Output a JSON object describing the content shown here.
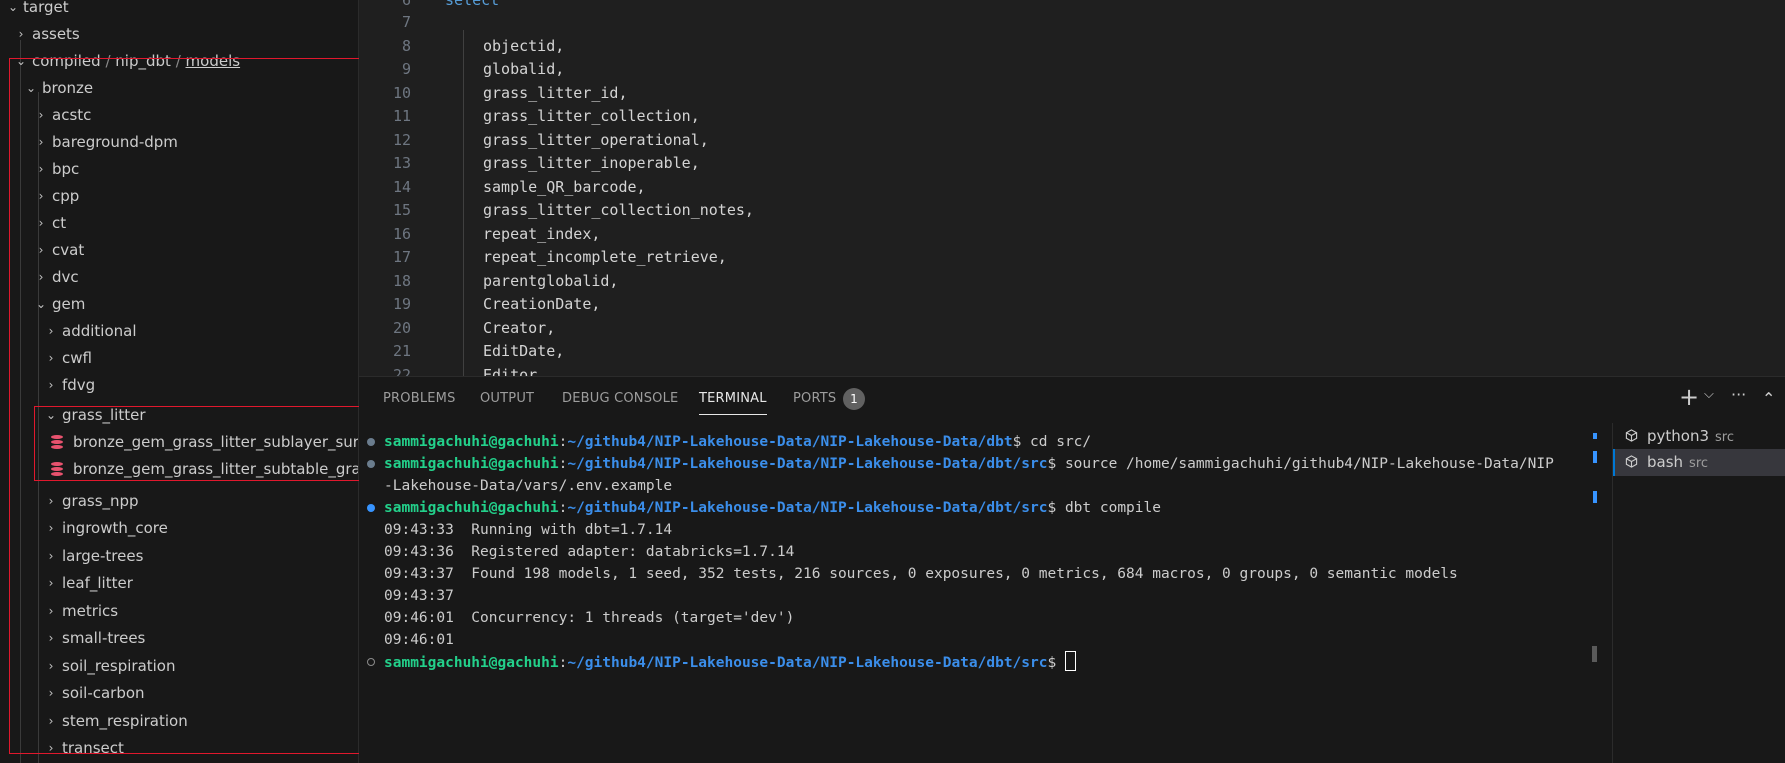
{
  "explorer": {
    "items": [
      {
        "label": "target",
        "expanded": true
      },
      {
        "label": "assets",
        "expanded": false
      },
      {
        "label_parts": [
          "compiled",
          "/",
          "nip_dbt",
          "/",
          "models"
        ],
        "expanded": true
      },
      {
        "label": "bronze",
        "expanded": true
      },
      {
        "label": "acstc",
        "expanded": false
      },
      {
        "label": "bareground-dpm",
        "expanded": false
      },
      {
        "label": "bpc",
        "expanded": false
      },
      {
        "label": "cpp",
        "expanded": false
      },
      {
        "label": "ct",
        "expanded": false
      },
      {
        "label": "cvat",
        "expanded": false
      },
      {
        "label": "dvc",
        "expanded": false
      },
      {
        "label": "gem",
        "expanded": true
      },
      {
        "label": "additional",
        "expanded": false
      },
      {
        "label": "cwfl",
        "expanded": false
      },
      {
        "label": "fdvg",
        "expanded": false
      },
      {
        "label": "grass_litter",
        "expanded": true
      },
      {
        "label": "bronze_gem_grass_litter_sublayer_sur...",
        "file": true
      },
      {
        "label": "bronze_gem_grass_litter_subtable_gra...",
        "file": true
      },
      {
        "label": "grass_npp",
        "expanded": false
      },
      {
        "label": "ingrowth_core",
        "expanded": false
      },
      {
        "label": "large-trees",
        "expanded": false
      },
      {
        "label": "leaf_litter",
        "expanded": false
      },
      {
        "label": "metrics",
        "expanded": false
      },
      {
        "label": "small-trees",
        "expanded": false
      },
      {
        "label": "soil_respiration",
        "expanded": false
      },
      {
        "label": "soil-carbon",
        "expanded": false
      },
      {
        "label": "stem_respiration",
        "expanded": false
      },
      {
        "label": "transect",
        "expanded": false
      }
    ]
  },
  "editor": {
    "lines": [
      {
        "num": "6",
        "code": "select",
        "keyword": true
      },
      {
        "num": "7",
        "code": ""
      },
      {
        "num": "8",
        "code": "objectid,"
      },
      {
        "num": "9",
        "code": "globalid,"
      },
      {
        "num": "10",
        "code": "grass_litter_id,"
      },
      {
        "num": "11",
        "code": "grass_litter_collection,"
      },
      {
        "num": "12",
        "code": "grass_litter_operational,"
      },
      {
        "num": "13",
        "code": "grass_litter_inoperable,"
      },
      {
        "num": "14",
        "code": "sample_QR_barcode,"
      },
      {
        "num": "15",
        "code": "grass_litter_collection_notes,"
      },
      {
        "num": "16",
        "code": "repeat_index,"
      },
      {
        "num": "17",
        "code": "repeat_incomplete_retrieve,"
      },
      {
        "num": "18",
        "code": "parentglobalid,"
      },
      {
        "num": "19",
        "code": "CreationDate,"
      },
      {
        "num": "20",
        "code": "Creator,"
      },
      {
        "num": "21",
        "code": "EditDate,"
      },
      {
        "num": "22",
        "code": "Editor,"
      }
    ]
  },
  "panel": {
    "tabs": [
      "PROBLEMS",
      "OUTPUT",
      "DEBUG CONSOLE",
      "TERMINAL",
      "PORTS"
    ],
    "active_tab": "TERMINAL",
    "ports_badge": "1",
    "actions": {
      "add": "+",
      "dropdown": "⌵",
      "more": "···",
      "collapse": "⌃"
    }
  },
  "terminal": {
    "user": "sammigachuhi@gachuhi",
    "lines": [
      {
        "prompt": true,
        "path": "~/github4/NIP-Lakehouse-Data/NIP-Lakehouse-Data/dbt",
        "cmd": " cd src/",
        "dot": "filled"
      },
      {
        "prompt": true,
        "path": "~/github4/NIP-Lakehouse-Data/NIP-Lakehouse-Data/dbt/src",
        "cmd": " source /home/sammigachuhi/github4/NIP-Lakehouse-Data/NIP",
        "dot": "filled"
      },
      {
        "text": "-Lakehouse-Data/vars/.env.example"
      },
      {
        "prompt": true,
        "path": "~/github4/NIP-Lakehouse-Data/NIP-Lakehouse-Data/dbt/src",
        "cmd": " dbt compile",
        "dot": "blue"
      },
      {
        "text": "09:43:33  Running with dbt=1.7.14"
      },
      {
        "text": "09:43:36  Registered adapter: databricks=1.7.14"
      },
      {
        "text": "09:43:37  Found 198 models, 1 seed, 352 tests, 216 sources, 0 exposures, 0 metrics, 684 macros, 0 groups, 0 semantic models"
      },
      {
        "text": "09:43:37"
      },
      {
        "text": "09:46:01  Concurrency: 1 threads (target='dev')"
      },
      {
        "text": "09:46:01"
      },
      {
        "prompt": true,
        "path": "~/github4/NIP-Lakehouse-Data/NIP-Lakehouse-Data/dbt/src",
        "cmd": " ",
        "dot": "hollow",
        "cursor": true
      }
    ],
    "sessions": [
      {
        "name": "python3",
        "sub": "src",
        "selected": false
      },
      {
        "name": "bash",
        "sub": "src",
        "selected": true
      }
    ]
  },
  "colors": {
    "highlight_box": "#e0182d",
    "accent": "#0078d4",
    "prompt_user": "#23d18b",
    "prompt_path": "#3b8eea"
  }
}
